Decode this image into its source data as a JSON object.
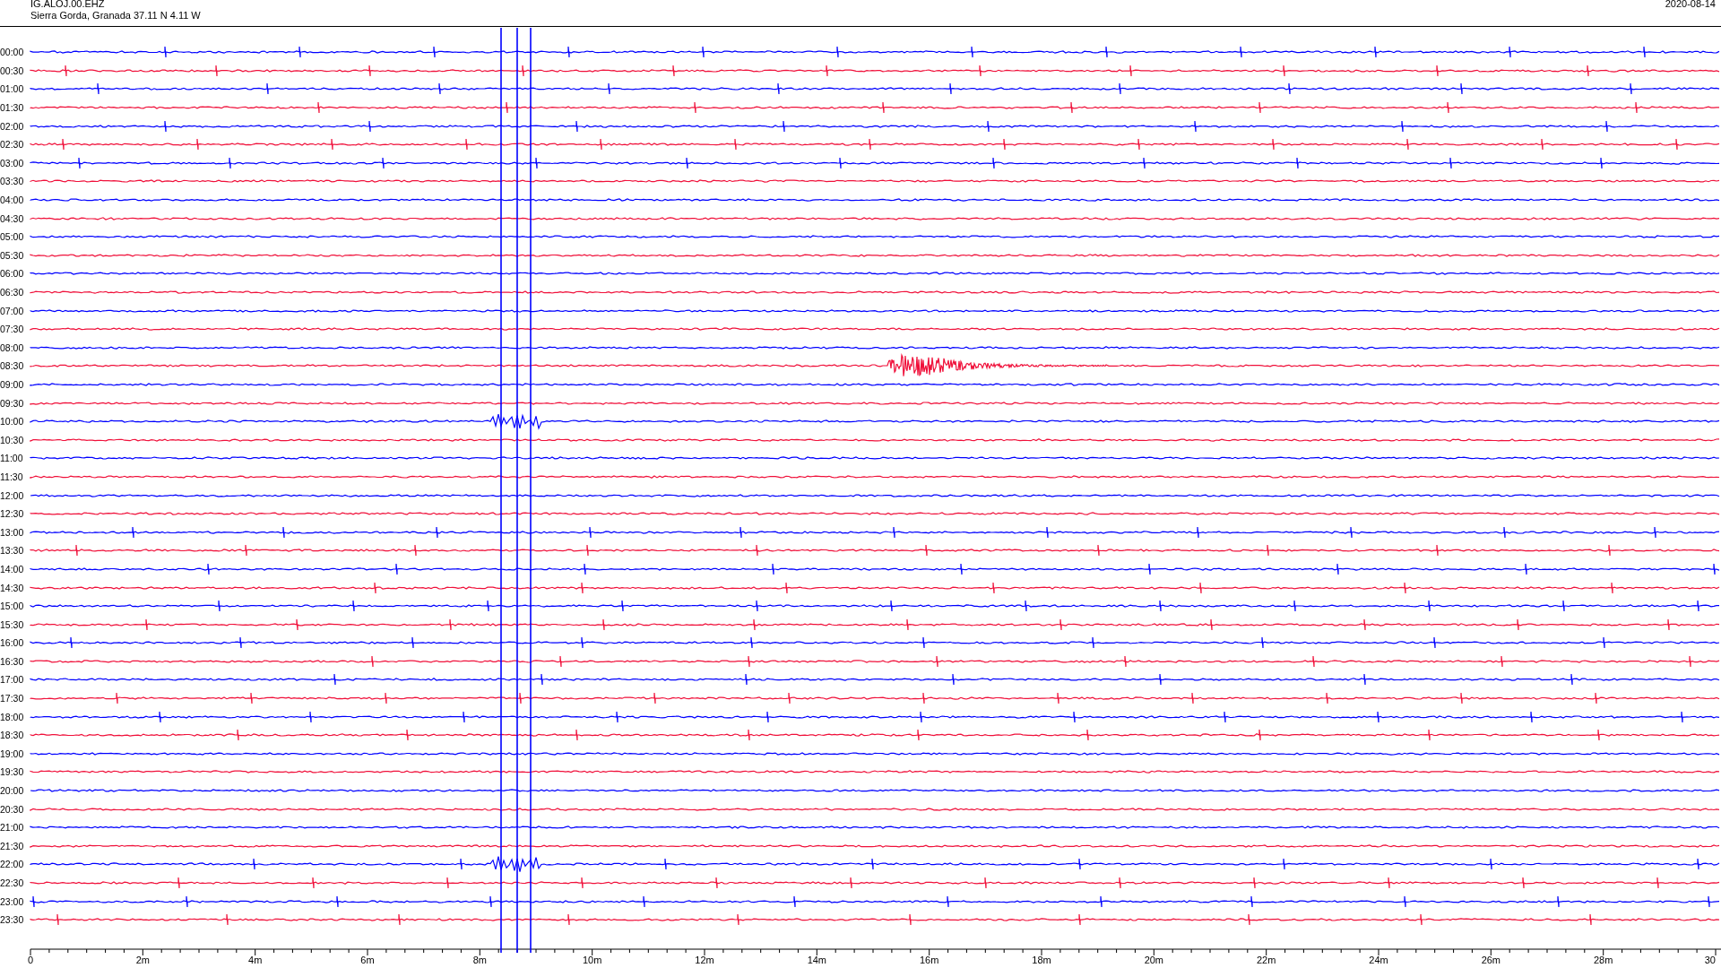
{
  "header": {
    "station": "IG.ALOJ.00.EHZ",
    "location": "Sierra Gorda, Granada  37.11 N 4.11 W",
    "date": "2020-08-14"
  },
  "rows": [
    {
      "time": "00:00",
      "color": "#0000ff"
    },
    {
      "time": "00:30",
      "color": "#f0103a"
    },
    {
      "time": "01:00",
      "color": "#0000ff"
    },
    {
      "time": "01:30",
      "color": "#f0103a"
    },
    {
      "time": "02:00",
      "color": "#0000ff"
    },
    {
      "time": "02:30",
      "color": "#f0103a"
    },
    {
      "time": "03:00",
      "color": "#0000ff"
    },
    {
      "time": "03:30",
      "color": "#f0103a"
    },
    {
      "time": "04:00",
      "color": "#0000ff"
    },
    {
      "time": "04:30",
      "color": "#f0103a"
    },
    {
      "time": "05:00",
      "color": "#0000ff"
    },
    {
      "time": "05:30",
      "color": "#f0103a"
    },
    {
      "time": "06:00",
      "color": "#0000ff"
    },
    {
      "time": "06:30",
      "color": "#f0103a"
    },
    {
      "time": "07:00",
      "color": "#0000ff"
    },
    {
      "time": "07:30",
      "color": "#f0103a"
    },
    {
      "time": "08:00",
      "color": "#0000ff"
    },
    {
      "time": "08:30",
      "color": "#f0103a"
    },
    {
      "time": "09:00",
      "color": "#0000ff"
    },
    {
      "time": "09:30",
      "color": "#f0103a"
    },
    {
      "time": "10:00",
      "color": "#0000ff"
    },
    {
      "time": "10:30",
      "color": "#f0103a"
    },
    {
      "time": "11:00",
      "color": "#0000ff"
    },
    {
      "time": "11:30",
      "color": "#f0103a"
    },
    {
      "time": "12:00",
      "color": "#0000ff"
    },
    {
      "time": "12:30",
      "color": "#f0103a"
    },
    {
      "time": "13:00",
      "color": "#0000ff"
    },
    {
      "time": "13:30",
      "color": "#f0103a"
    },
    {
      "time": "14:00",
      "color": "#0000ff"
    },
    {
      "time": "14:30",
      "color": "#f0103a"
    },
    {
      "time": "15:00",
      "color": "#0000ff"
    },
    {
      "time": "15:30",
      "color": "#f0103a"
    },
    {
      "time": "16:00",
      "color": "#0000ff"
    },
    {
      "time": "16:30",
      "color": "#f0103a"
    },
    {
      "time": "17:00",
      "color": "#0000ff"
    },
    {
      "time": "17:30",
      "color": "#f0103a"
    },
    {
      "time": "18:00",
      "color": "#0000ff"
    },
    {
      "time": "18:30",
      "color": "#f0103a"
    },
    {
      "time": "19:00",
      "color": "#0000ff"
    },
    {
      "time": "19:30",
      "color": "#f0103a"
    },
    {
      "time": "20:00",
      "color": "#0000ff"
    },
    {
      "time": "20:30",
      "color": "#f0103a"
    },
    {
      "time": "21:00",
      "color": "#0000ff"
    },
    {
      "time": "21:30",
      "color": "#f0103a"
    },
    {
      "time": "22:00",
      "color": "#0000ff"
    },
    {
      "time": "22:30",
      "color": "#f0103a"
    },
    {
      "time": "23:00",
      "color": "#0000ff"
    },
    {
      "time": "23:30",
      "color": "#f0103a"
    }
  ],
  "axis": {
    "labels": [
      "0",
      "2m",
      "4m",
      "6m",
      "8m",
      "10m",
      "12m",
      "14m",
      "16m",
      "18m",
      "20m",
      "22m",
      "24m",
      "26m",
      "28m",
      "30"
    ]
  }
}
